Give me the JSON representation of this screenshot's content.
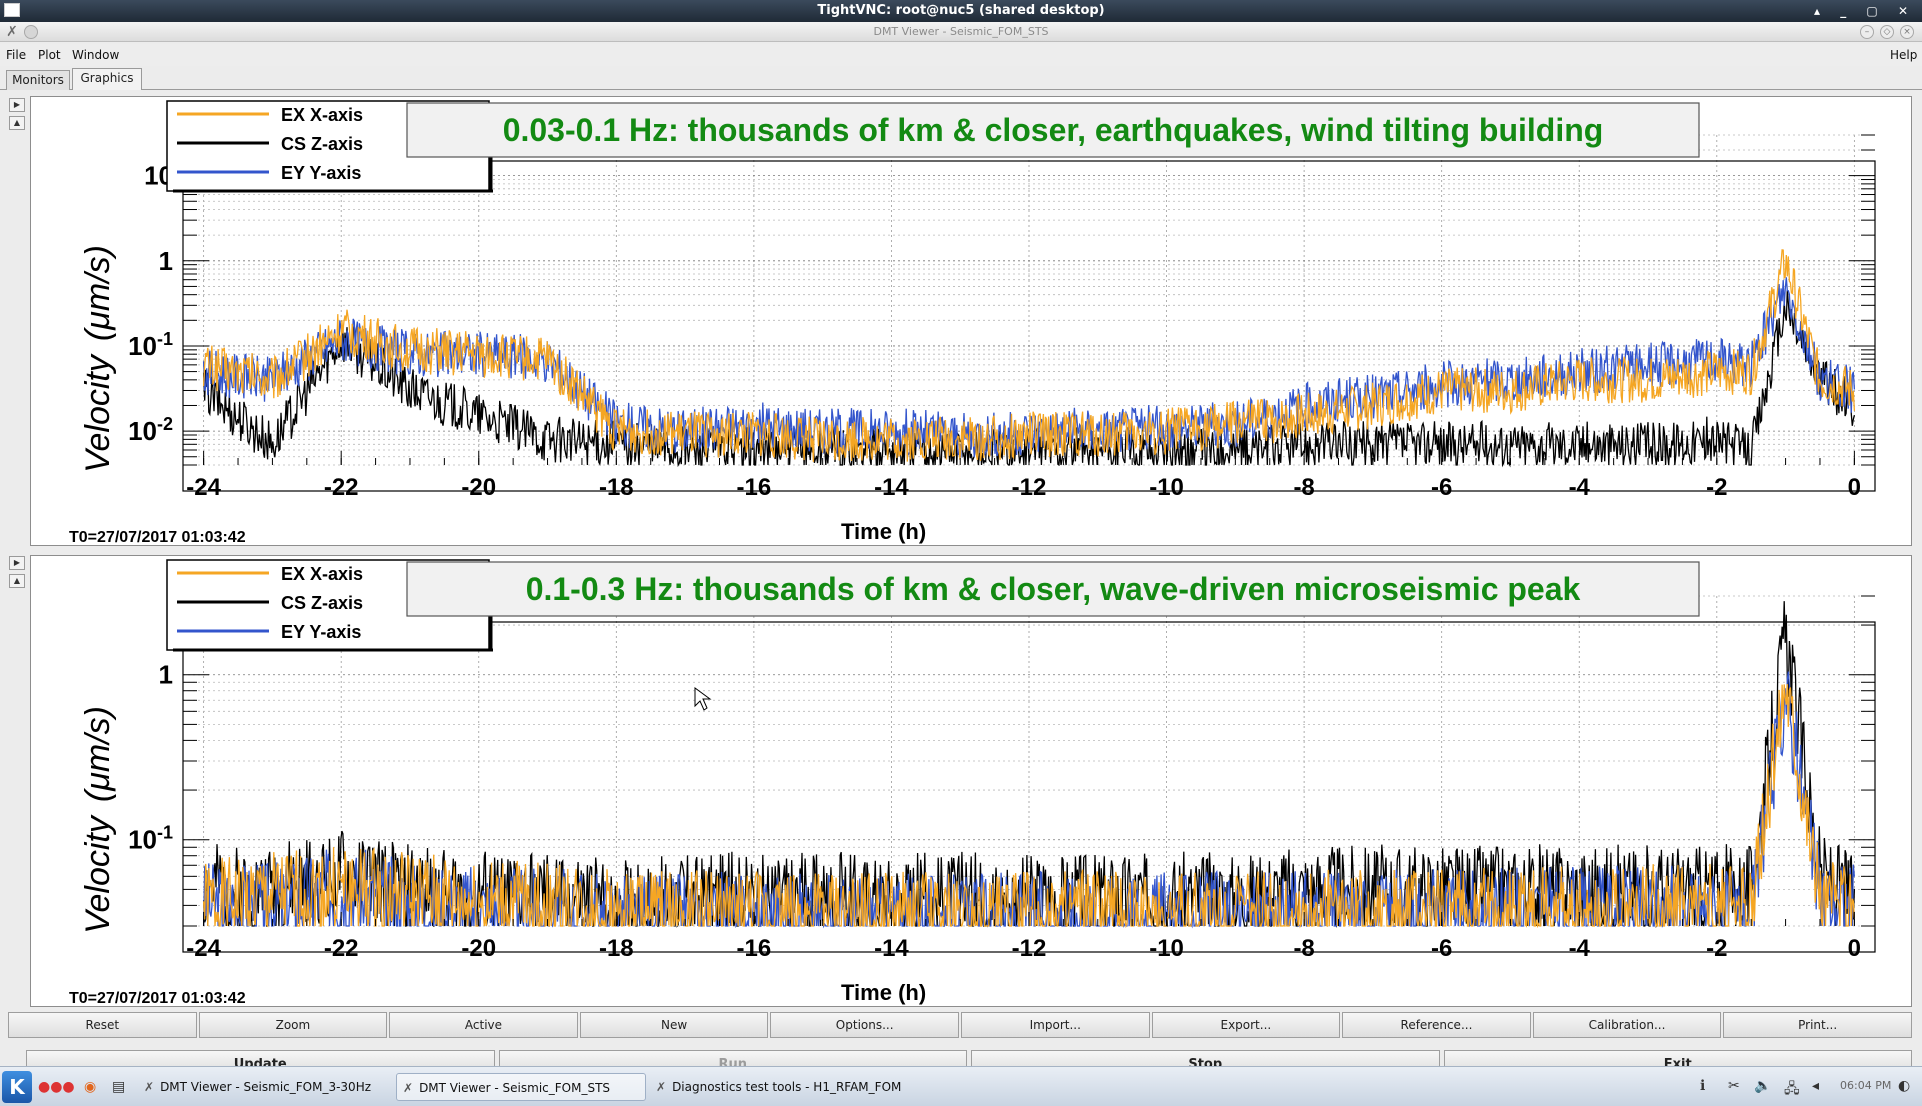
{
  "vnc": {
    "title": "TightVNC: root@nuc5 (shared desktop)"
  },
  "window": {
    "title": "DMT Viewer - Seismic_FOM_STS"
  },
  "menu": {
    "file": "File",
    "plot": "Plot",
    "window": "Window",
    "help": "Help"
  },
  "tabs": [
    {
      "label": "Monitors"
    },
    {
      "label": "Graphics"
    }
  ],
  "colors": {
    "ex": "#f5a623",
    "cs": "#000000",
    "ey": "#3355cc",
    "title_text": "#138a13"
  },
  "legend": {
    "ex": "EX X-axis",
    "cs": "CS Z-axis",
    "ey": "EY Y-axis"
  },
  "plot1": {
    "title": "0.03-0.1 Hz: thousands of km & closer, earthquakes, wind tilting building",
    "ylabel_text": "Velocity",
    "ylabel_unit": "(μm/s)",
    "xlabel": "Time (h)",
    "t0": "T0=27/07/2017 01:03:42",
    "xticks": [
      "-24",
      "-22",
      "-20",
      "-18",
      "-16",
      "-14",
      "-12",
      "-10",
      "-8",
      "-6",
      "-4",
      "-2",
      "0"
    ],
    "yticks": [
      {
        "mant": "10",
        "exp": ""
      },
      {
        "mant": "1",
        "exp": ""
      },
      {
        "mant": "10",
        "exp": "-1"
      },
      {
        "mant": "10",
        "exp": "-2"
      }
    ]
  },
  "plot2": {
    "title": "0.1-0.3 Hz: thousands of km & closer, wave-driven microseismic peak",
    "ylabel_text": "Velocity",
    "ylabel_unit": "(μm/s)",
    "xlabel": "Time (h)",
    "t0": "T0=27/07/2017 01:03:42",
    "xticks": [
      "-24",
      "-22",
      "-20",
      "-18",
      "-16",
      "-14",
      "-12",
      "-10",
      "-8",
      "-6",
      "-4",
      "-2",
      "0"
    ],
    "yticks": [
      {
        "mant": "1",
        "exp": ""
      },
      {
        "mant": "10",
        "exp": "-1"
      }
    ]
  },
  "buttons": [
    "Reset",
    "Zoom",
    "Active",
    "New",
    "Options...",
    "Import...",
    "Export...",
    "Reference...",
    "Calibration...",
    "Print..."
  ],
  "buttons2": [
    "Update",
    "Run",
    "Stop",
    "Exit"
  ],
  "taskbar": {
    "tasks": [
      "DMT Viewer - Seismic_FOM_3-30Hz",
      "DMT Viewer - Seismic_FOM_STS",
      "Diagnostics test tools - H1_RFAM_FOM"
    ],
    "clock": "06:04 PM"
  },
  "chart_data": [
    {
      "type": "line",
      "title": "0.03-0.1 Hz: thousands of km & closer, earthquakes, wind tilting building",
      "xlabel": "Time (h)",
      "ylabel": "Velocity (μm/s)",
      "xlim": [
        -24.3,
        0.3
      ],
      "ylim": [
        0.004,
        30
      ],
      "yscale": "log",
      "grid": true,
      "legend_position": "top-left",
      "x": [
        -24,
        -23,
        -22,
        -21,
        -20,
        -19,
        -18,
        -17,
        -16,
        -15,
        -14,
        -13,
        -12,
        -11,
        -10,
        -9,
        -8,
        -7,
        -6,
        -5,
        -4,
        -3,
        -2,
        -1.5,
        -1,
        -0.5,
        0
      ],
      "series": [
        {
          "name": "EX X-axis",
          "values": [
            0.06,
            0.04,
            0.15,
            0.09,
            0.08,
            0.07,
            0.01,
            0.009,
            0.009,
            0.008,
            0.008,
            0.008,
            0.009,
            0.009,
            0.01,
            0.012,
            0.015,
            0.02,
            0.03,
            0.03,
            0.04,
            0.04,
            0.05,
            0.05,
            1.0,
            0.04,
            0.03
          ]
        },
        {
          "name": "CS Z-axis",
          "values": [
            0.03,
            0.007,
            0.12,
            0.03,
            0.015,
            0.008,
            0.007,
            0.006,
            0.006,
            0.006,
            0.006,
            0.006,
            0.006,
            0.006,
            0.006,
            0.006,
            0.007,
            0.007,
            0.007,
            0.007,
            0.007,
            0.007,
            0.008,
            0.006,
            0.3,
            0.04,
            0.02
          ]
        },
        {
          "name": "EY Y-axis",
          "values": [
            0.05,
            0.04,
            0.12,
            0.08,
            0.08,
            0.07,
            0.012,
            0.01,
            0.012,
            0.01,
            0.01,
            0.009,
            0.01,
            0.01,
            0.011,
            0.012,
            0.02,
            0.025,
            0.035,
            0.04,
            0.05,
            0.06,
            0.07,
            0.06,
            0.5,
            0.04,
            0.03
          ]
        }
      ]
    },
    {
      "type": "line",
      "title": "0.1-0.3 Hz: thousands of km & closer, wave-driven microseismic peak",
      "xlabel": "Time (h)",
      "ylabel": "Velocity (μm/s)",
      "xlim": [
        -24.3,
        0.3
      ],
      "ylim": [
        0.03,
        3
      ],
      "yscale": "log",
      "grid": true,
      "legend_position": "top-left",
      "x": [
        -24,
        -23,
        -22,
        -21,
        -20,
        -19,
        -18,
        -17,
        -16,
        -15,
        -14,
        -13,
        -12,
        -11,
        -10,
        -9,
        -8,
        -7,
        -6,
        -5,
        -4,
        -3,
        -2,
        -1.5,
        -1,
        -0.5,
        0
      ],
      "series": [
        {
          "name": "EX X-axis",
          "values": [
            0.04,
            0.045,
            0.05,
            0.045,
            0.04,
            0.04,
            0.035,
            0.035,
            0.035,
            0.034,
            0.034,
            0.034,
            0.035,
            0.035,
            0.034,
            0.034,
            0.035,
            0.035,
            0.036,
            0.036,
            0.037,
            0.038,
            0.038,
            0.035,
            1.0,
            0.045,
            0.04
          ]
        },
        {
          "name": "CS Z-axis",
          "values": [
            0.05,
            0.05,
            0.06,
            0.05,
            0.045,
            0.045,
            0.04,
            0.045,
            0.045,
            0.045,
            0.045,
            0.045,
            0.045,
            0.045,
            0.045,
            0.045,
            0.05,
            0.05,
            0.05,
            0.05,
            0.05,
            0.05,
            0.05,
            0.05,
            1.8,
            0.06,
            0.045
          ]
        },
        {
          "name": "EY Y-axis",
          "values": [
            0.04,
            0.04,
            0.05,
            0.04,
            0.038,
            0.036,
            0.034,
            0.034,
            0.034,
            0.033,
            0.033,
            0.033,
            0.034,
            0.034,
            0.034,
            0.034,
            0.035,
            0.035,
            0.036,
            0.036,
            0.037,
            0.037,
            0.037,
            0.034,
            0.8,
            0.045,
            0.04
          ]
        }
      ]
    }
  ]
}
